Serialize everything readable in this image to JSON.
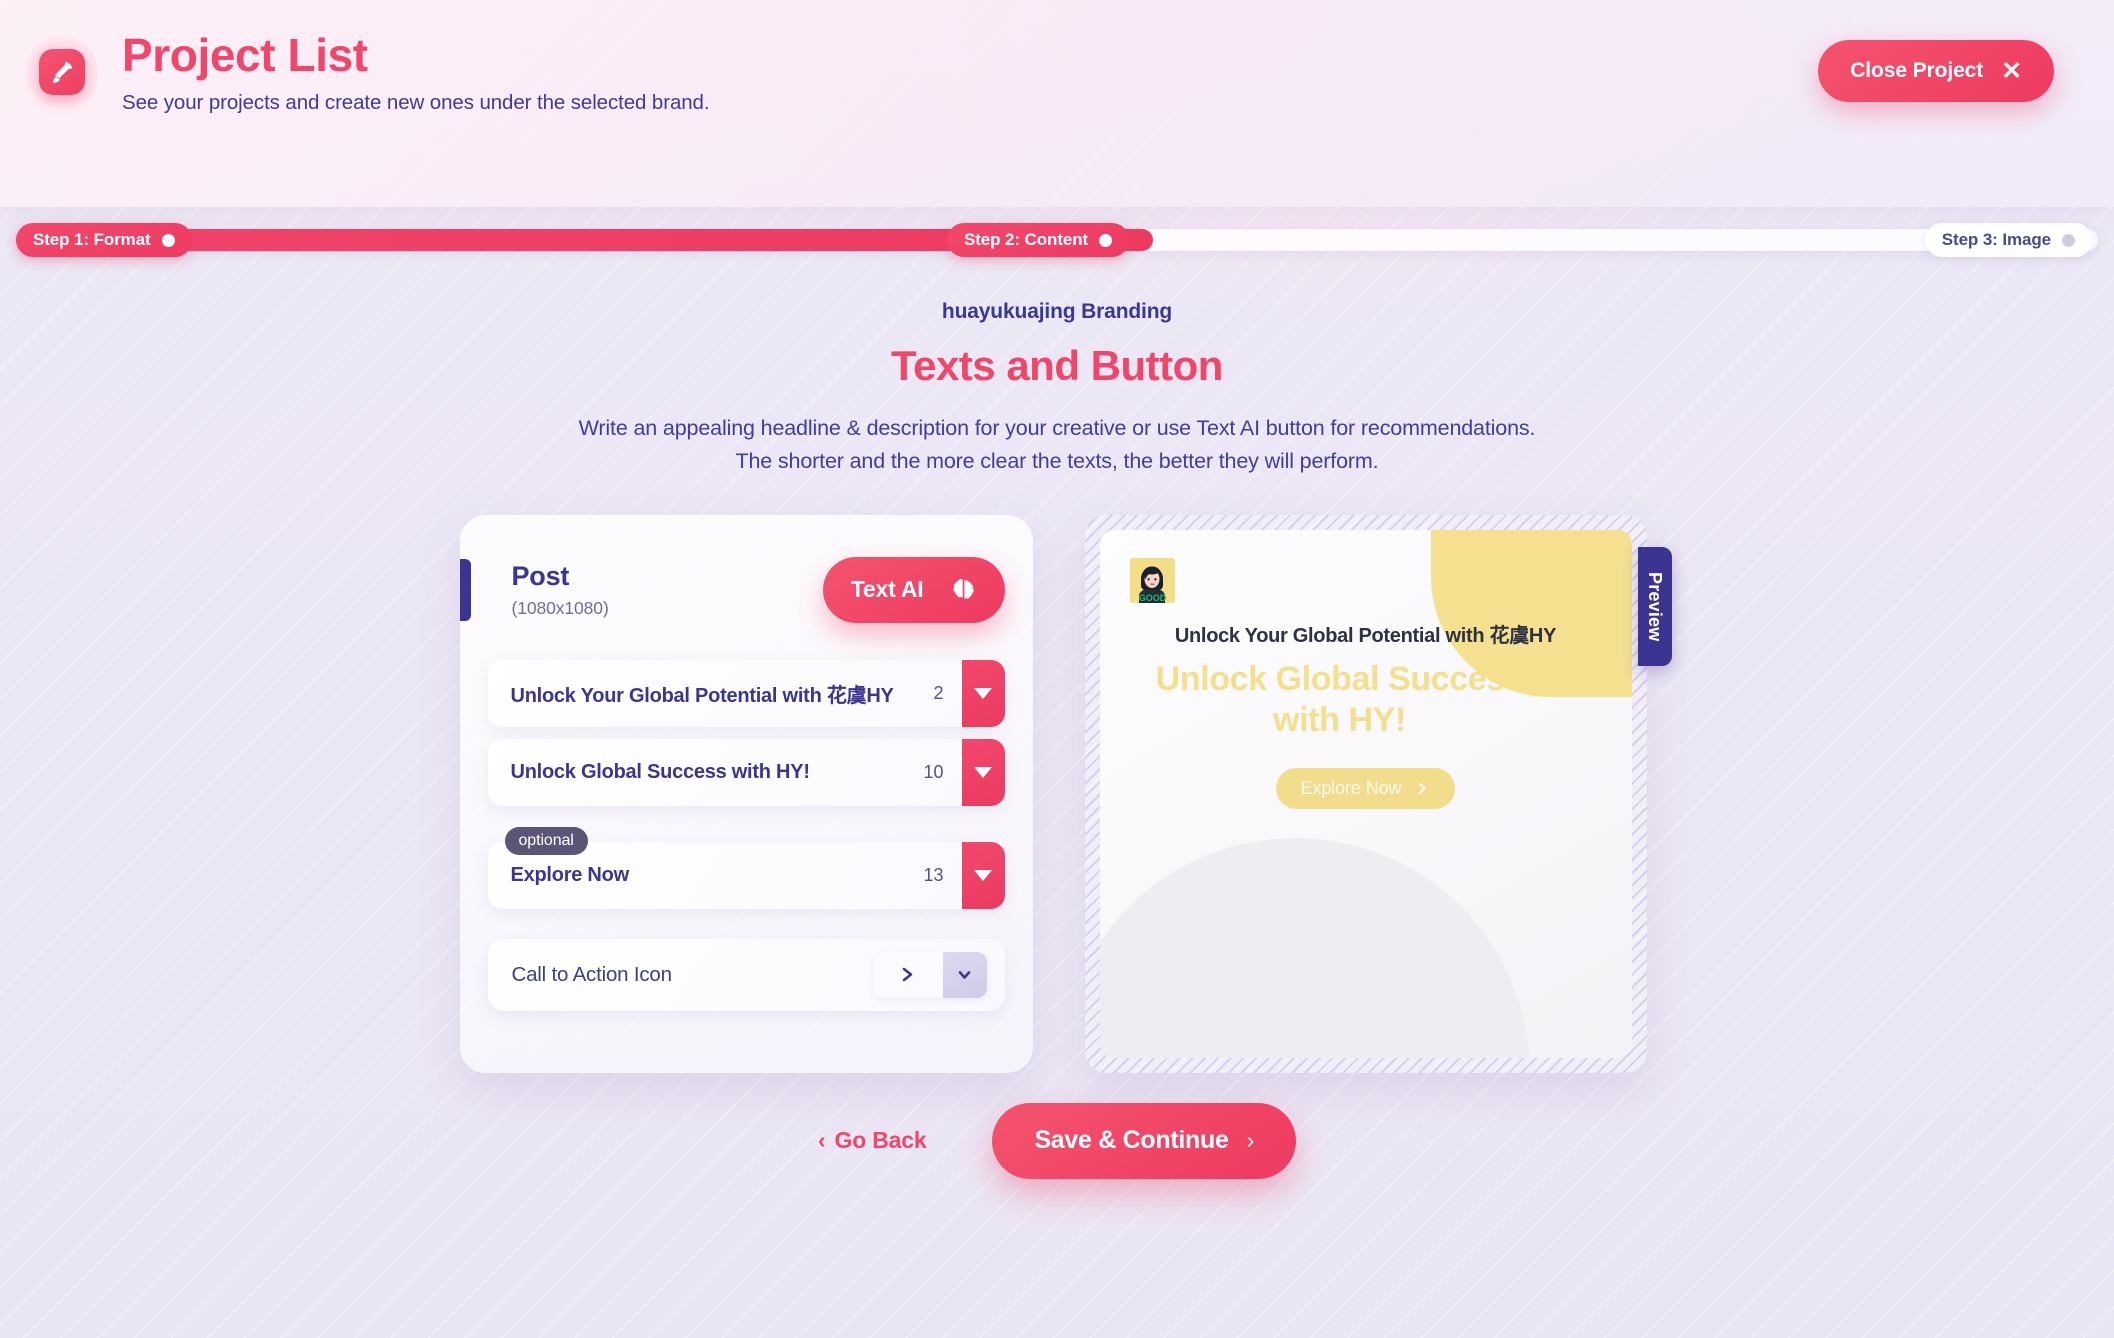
{
  "colors": {
    "accent_pink": "#f2456a",
    "deep_purple": "#3b3591",
    "preview_yellow": "#f3df8c",
    "badge_gray": "#5d5576"
  },
  "header": {
    "icon": "rocket-icon",
    "title": "Project List",
    "subtitle": "See your projects and create new ones under the selected brand.",
    "close_button": {
      "label": "Close Project",
      "icon": "close-icon",
      "glyph": "✕"
    }
  },
  "stepper": {
    "steps": [
      {
        "label": "Step 1: Format",
        "state": "active"
      },
      {
        "label": "Step 2: Content",
        "state": "active"
      },
      {
        "label": "Step 3: Image",
        "state": "inactive"
      }
    ]
  },
  "main": {
    "brand_line": "huayukuajing Branding",
    "section_title": "Texts and Button",
    "description_line_1": "Write an appealing headline & description for your creative or use Text AI button for recommendations.",
    "description_line_2": "The shorter and the more clear the texts, the better they will perform."
  },
  "editor": {
    "format_name": "Post",
    "format_dimensions": "(1080x1080)",
    "text_ai_button": {
      "label": "Text AI",
      "icon": "brain-icon"
    },
    "rows": [
      {
        "value": "Unlock Your Global Potential with 花虞HY",
        "count": "2",
        "optional": false,
        "dropdown_icon": "caret-down-icon"
      },
      {
        "value": "Unlock Global Success with HY!",
        "count": "10",
        "optional": false,
        "dropdown_icon": "caret-down-icon"
      },
      {
        "value": "Explore Now",
        "count": "13",
        "optional": true,
        "optional_badge": "optional",
        "dropdown_icon": "caret-down-icon"
      }
    ],
    "cta_icon_row": {
      "label": "Call to Action Icon",
      "selected_icon": "chevron-right-icon",
      "toggle_icon": "chevron-down-icon"
    }
  },
  "preview": {
    "tab_label": "Preview",
    "avatar": "user-avatar",
    "headline": "Unlock Your Global Potential with 花虞HY",
    "title": "Unlock Global Success with HY!",
    "cta": {
      "label": "Explore Now",
      "icon": "chevron-right-icon"
    }
  },
  "footer": {
    "go_back": {
      "label": "Go Back",
      "icon": "chevron-left-icon",
      "glyph": "‹"
    },
    "save_continue": {
      "label": "Save & Continue",
      "icon": "chevron-right-icon",
      "glyph": "›"
    }
  }
}
